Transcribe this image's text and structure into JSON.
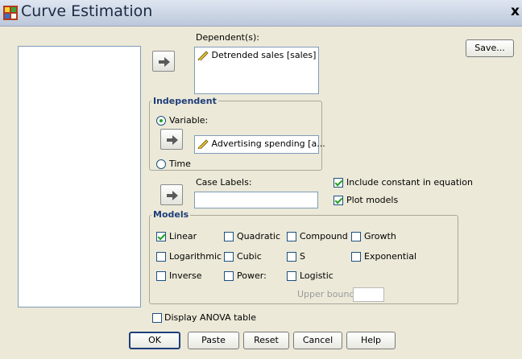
{
  "window": {
    "title": "Curve Estimation",
    "close_glyph": "x"
  },
  "dependent": {
    "label": "Dependent(s):",
    "items": [
      "Detrended sales [sales]"
    ]
  },
  "independent": {
    "legend": "Independent",
    "variable_label": "Variable:",
    "variable_value": "Advertising spending [a...",
    "time_label": "Time",
    "selected": "variable"
  },
  "case_labels": {
    "label": "Case Labels:",
    "value": ""
  },
  "options": {
    "include_constant": {
      "label": "Include constant in equation",
      "checked": true
    },
    "plot_models": {
      "label": "Plot models",
      "checked": true
    }
  },
  "models": {
    "legend": "Models",
    "items": [
      {
        "label": "Linear",
        "checked": true
      },
      {
        "label": "Quadratic",
        "checked": false
      },
      {
        "label": "Compound",
        "checked": false
      },
      {
        "label": "Growth",
        "checked": false
      },
      {
        "label": "Logarithmic",
        "checked": false
      },
      {
        "label": "Cubic",
        "checked": false
      },
      {
        "label": "S",
        "checked": false
      },
      {
        "label": "Exponential",
        "checked": false
      },
      {
        "label": "Inverse",
        "checked": false
      },
      {
        "label": "Power:",
        "checked": false
      },
      {
        "label": "Logistic",
        "checked": false
      }
    ],
    "upper_bound_label": "Upper bound:",
    "upper_bound_value": ""
  },
  "display_anova": {
    "label": "Display ANOVA table",
    "checked": false
  },
  "buttons": {
    "save": "Save...",
    "ok": "OK",
    "paste": "Paste",
    "reset": "Reset",
    "cancel": "Cancel",
    "help": "Help"
  },
  "icons": {
    "move": "arrow-right-icon",
    "variable": "ruler-icon",
    "app": "spss-icon"
  },
  "colors": {
    "accent": "#1f3d7a",
    "check": "#21a121",
    "dialog_bg": "#ECE9D8"
  }
}
